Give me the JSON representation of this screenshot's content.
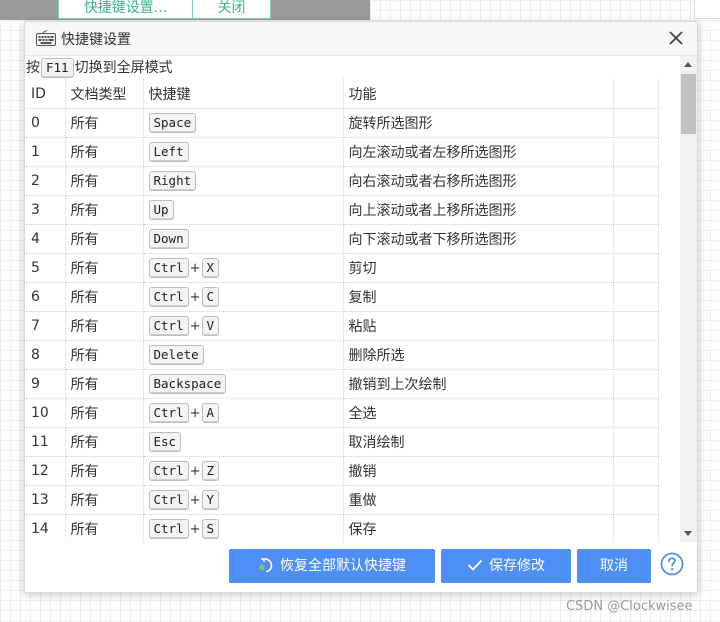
{
  "background": {
    "top_buttons": [
      "快捷键设置...",
      "关闭"
    ]
  },
  "dialog": {
    "title": "快捷键设置",
    "hint": {
      "prefix": "按",
      "key": "F11",
      "suffix": "切换到全屏模式"
    },
    "columns": [
      "ID",
      "文档类型",
      "快捷键",
      "功能",
      ""
    ],
    "rows": [
      {
        "id": "0",
        "type": "所有",
        "keys": [
          "Space"
        ],
        "func": "旋转所选图形"
      },
      {
        "id": "1",
        "type": "所有",
        "keys": [
          "Left"
        ],
        "func": "向左滚动或者左移所选图形"
      },
      {
        "id": "2",
        "type": "所有",
        "keys": [
          "Right"
        ],
        "func": "向右滚动或者右移所选图形"
      },
      {
        "id": "3",
        "type": "所有",
        "keys": [
          "Up"
        ],
        "func": "向上滚动或者上移所选图形"
      },
      {
        "id": "4",
        "type": "所有",
        "keys": [
          "Down"
        ],
        "func": "向下滚动或者下移所选图形"
      },
      {
        "id": "5",
        "type": "所有",
        "keys": [
          "Ctrl",
          "X"
        ],
        "func": "剪切"
      },
      {
        "id": "6",
        "type": "所有",
        "keys": [
          "Ctrl",
          "C"
        ],
        "func": "复制"
      },
      {
        "id": "7",
        "type": "所有",
        "keys": [
          "Ctrl",
          "V"
        ],
        "func": "粘贴"
      },
      {
        "id": "8",
        "type": "所有",
        "keys": [
          "Delete"
        ],
        "func": "删除所选"
      },
      {
        "id": "9",
        "type": "所有",
        "keys": [
          "Backspace"
        ],
        "func": "撤销到上次绘制"
      },
      {
        "id": "10",
        "type": "所有",
        "keys": [
          "Ctrl",
          "A"
        ],
        "func": "全选"
      },
      {
        "id": "11",
        "type": "所有",
        "keys": [
          "Esc"
        ],
        "func": "取消绘制"
      },
      {
        "id": "12",
        "type": "所有",
        "keys": [
          "Ctrl",
          "Z"
        ],
        "func": "撤销"
      },
      {
        "id": "13",
        "type": "所有",
        "keys": [
          "Ctrl",
          "Y"
        ],
        "func": "重做"
      },
      {
        "id": "14",
        "type": "所有",
        "keys": [
          "Ctrl",
          "S"
        ],
        "func": "保存"
      }
    ],
    "plus_sign": "+",
    "buttons": {
      "restore_label": "恢复全部默认快捷键",
      "save_label": "保存修改",
      "cancel_label": "取消"
    },
    "help_icon": "question-circle-icon",
    "accent_color": "#4d8ff5"
  },
  "watermark": "CSDN @Clockwisee"
}
